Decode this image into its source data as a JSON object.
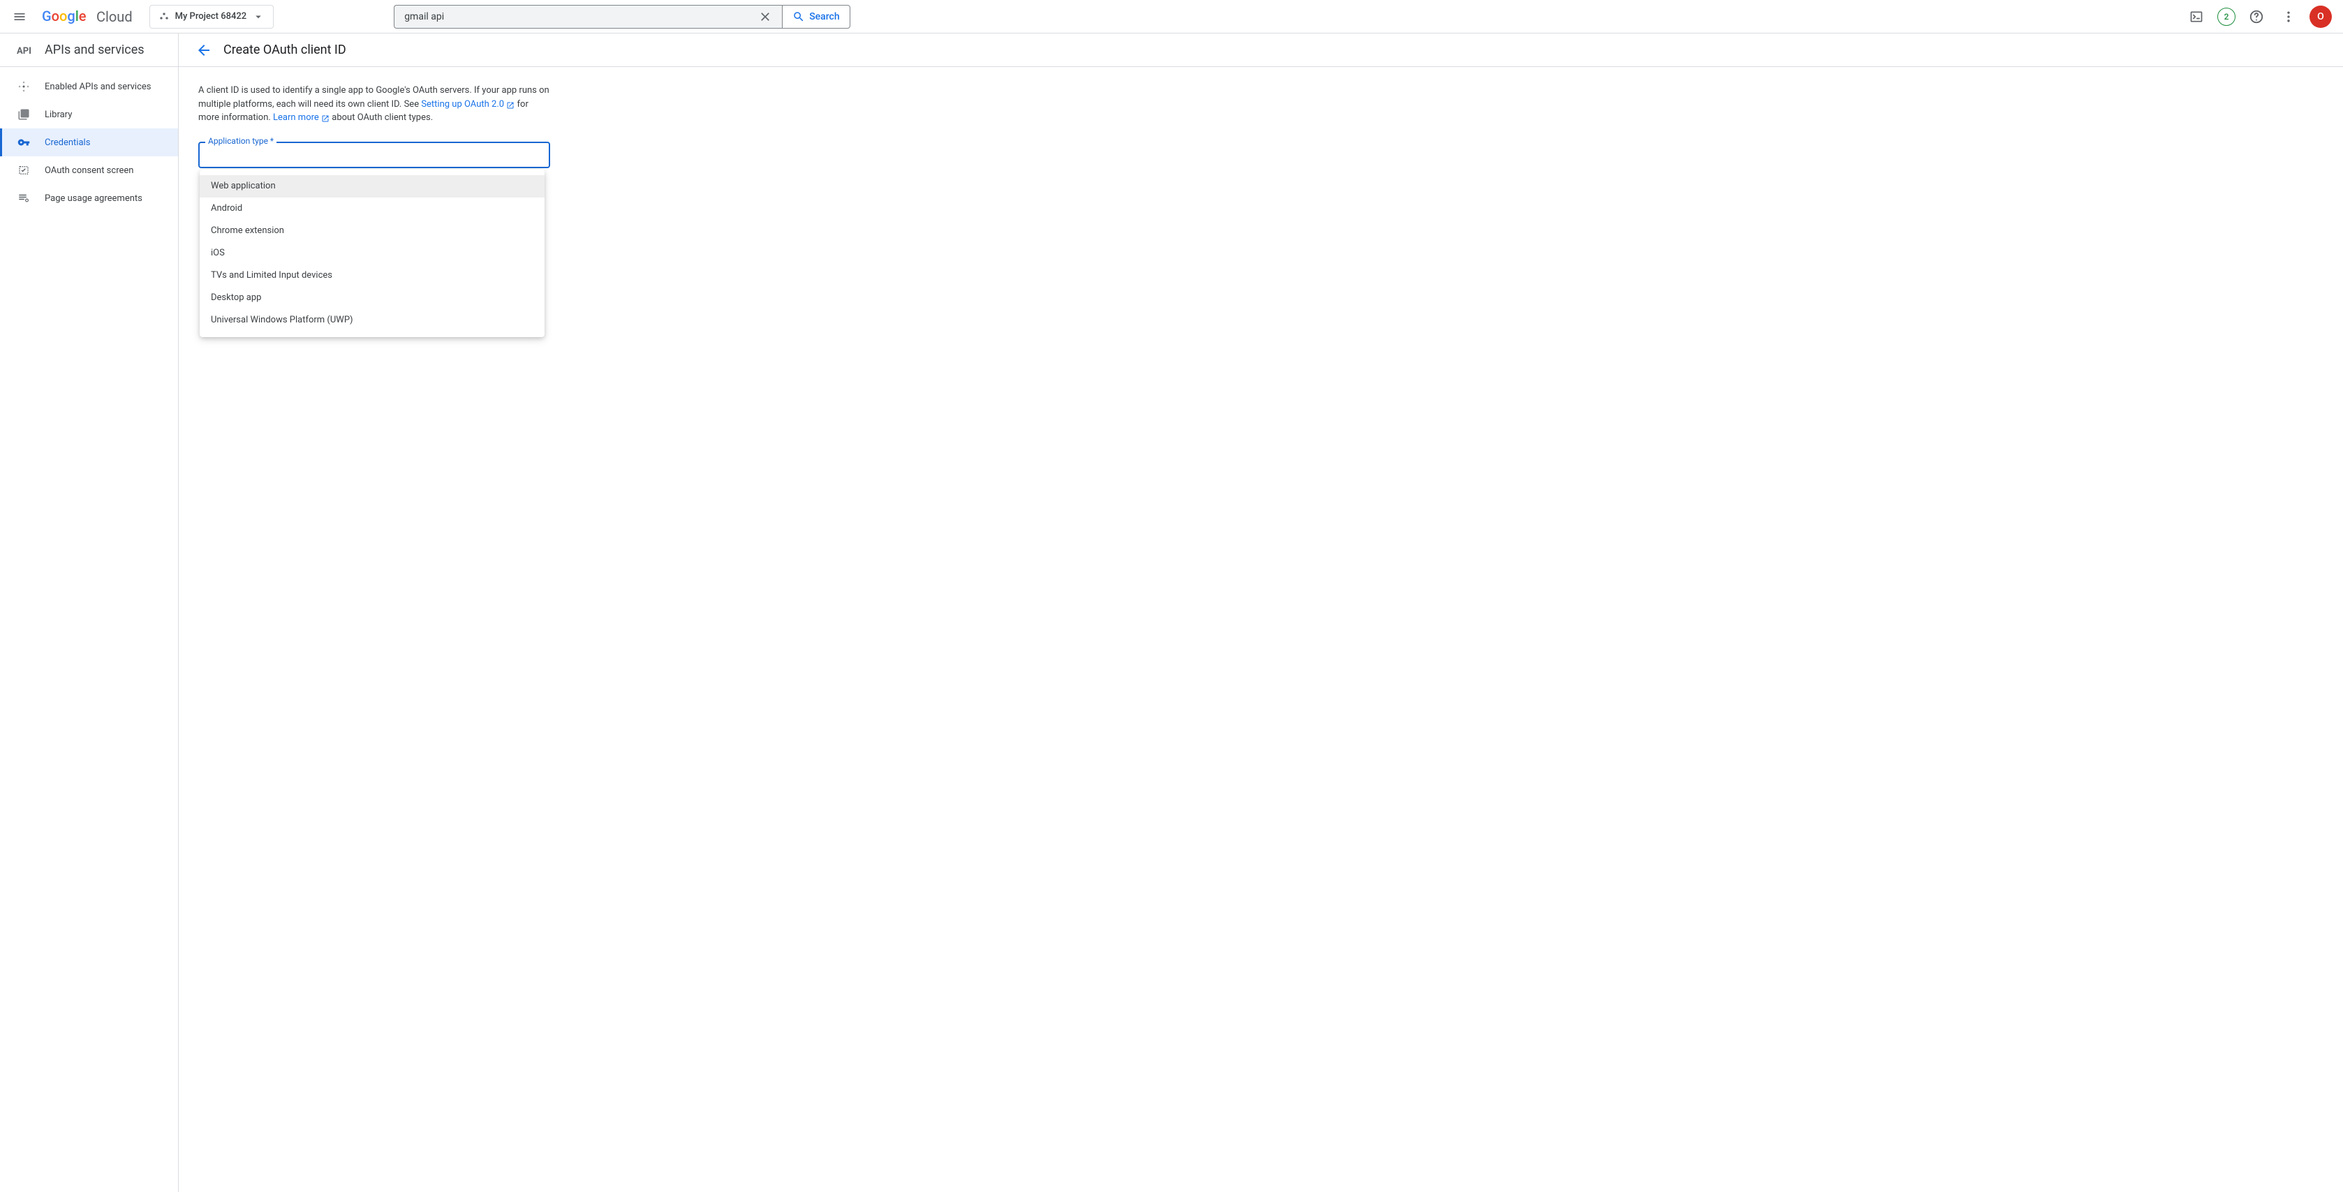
{
  "header": {
    "logo_cloud": "Cloud",
    "project_name": "My Project 68422",
    "search_value": "gmail api",
    "search_button_label": "Search",
    "trial_count": "2",
    "avatar_initial": "O"
  },
  "sidebar": {
    "title": "APIs and services",
    "items": [
      {
        "label": "Enabled APIs and services",
        "icon": "apis"
      },
      {
        "label": "Library",
        "icon": "library"
      },
      {
        "label": "Credentials",
        "icon": "key"
      },
      {
        "label": "OAuth consent screen",
        "icon": "consent"
      },
      {
        "label": "Page usage agreements",
        "icon": "agreements"
      }
    ],
    "active_index": 2
  },
  "page": {
    "title": "Create OAuth client ID",
    "description_part1": "A client ID is used to identify a single app to Google's OAuth servers. If your app runs on multiple platforms, each will need its own client ID. See ",
    "link_oauth": "Setting up OAuth 2.0",
    "description_part2": " for more information. ",
    "link_learn_more": "Learn more",
    "description_part3": " about OAuth client types."
  },
  "select": {
    "label": "Application type *",
    "options": [
      "Web application",
      "Android",
      "Chrome extension",
      "iOS",
      "TVs and Limited Input devices",
      "Desktop app",
      "Universal Windows Platform (UWP)"
    ],
    "highlighted_index": 0
  }
}
